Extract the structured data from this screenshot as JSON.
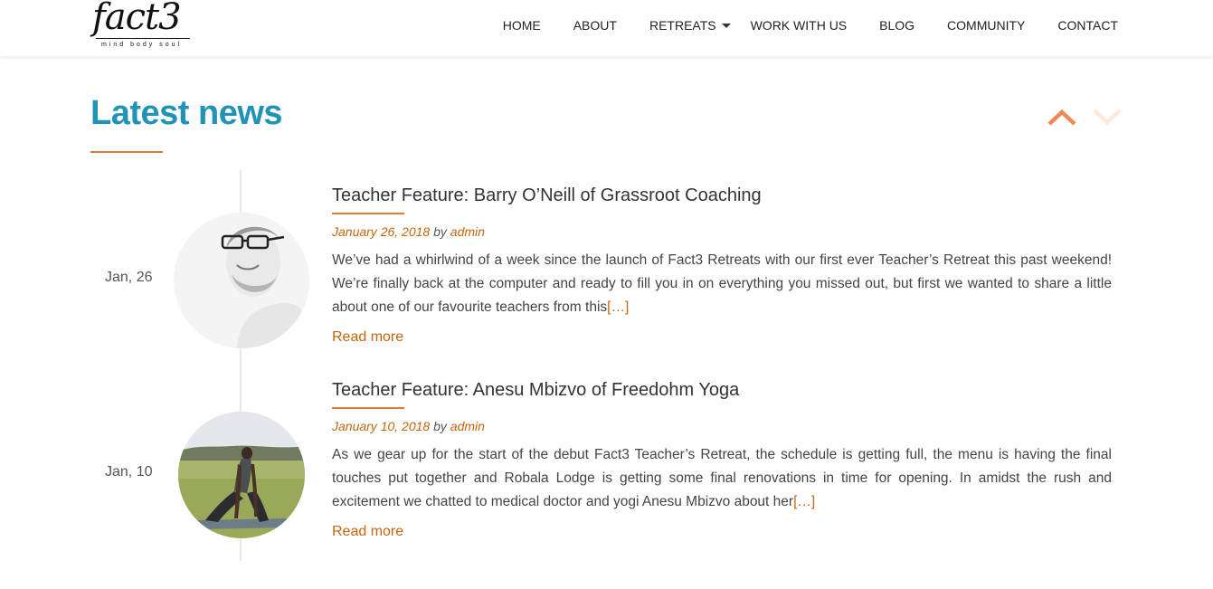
{
  "brand": {
    "name": "fact3",
    "tagline": "mind  body  soul"
  },
  "nav": {
    "items": [
      {
        "label": "HOME"
      },
      {
        "label": "ABOUT"
      },
      {
        "label": "RETREATS",
        "has_dropdown": true
      },
      {
        "label": "WORK WITH US"
      },
      {
        "label": "BLOG"
      },
      {
        "label": "COMMUNITY"
      },
      {
        "label": "CONTACT"
      }
    ]
  },
  "section": {
    "title": "Latest news",
    "accent_color": "#2193b5",
    "rule_color": "#e07b3c"
  },
  "controls": {
    "up_icon": "chevron-up-icon",
    "down_icon": "chevron-down-icon"
  },
  "posts": [
    {
      "date_short": "Jan, 26",
      "title": "Teacher Feature: Barry O’Neill of Grassroot Coaching",
      "date_full": "January 26, 2018",
      "by": "by",
      "author": "admin",
      "excerpt": "We’ve had a whirlwind of a week since the launch of Fact3 Retreats with our first ever Teacher’s Retreat this past weekend! We’re finally back at the computer and ready to fill you in on everything you missed out, but first we wanted to share a little about one of our favourite teachers from this",
      "ellipsis": "[…]",
      "read_more": "Read more"
    },
    {
      "date_short": "Jan, 10",
      "title": "Teacher Feature: Anesu Mbizvo of Freedohm Yoga",
      "date_full": "January 10, 2018",
      "by": "by",
      "author": "admin",
      "excerpt": "As we gear up for the start of the debut Fact3 Teacher’s Retreat, the schedule is getting full, the menu is having the final touches put together and Robala Lodge is getting some final renovations in time for opening. In amidst the rush and excitement we chatted to medical doctor and yogi Anesu Mbizvo about her",
      "ellipsis": "[…]",
      "read_more": "Read more"
    }
  ]
}
